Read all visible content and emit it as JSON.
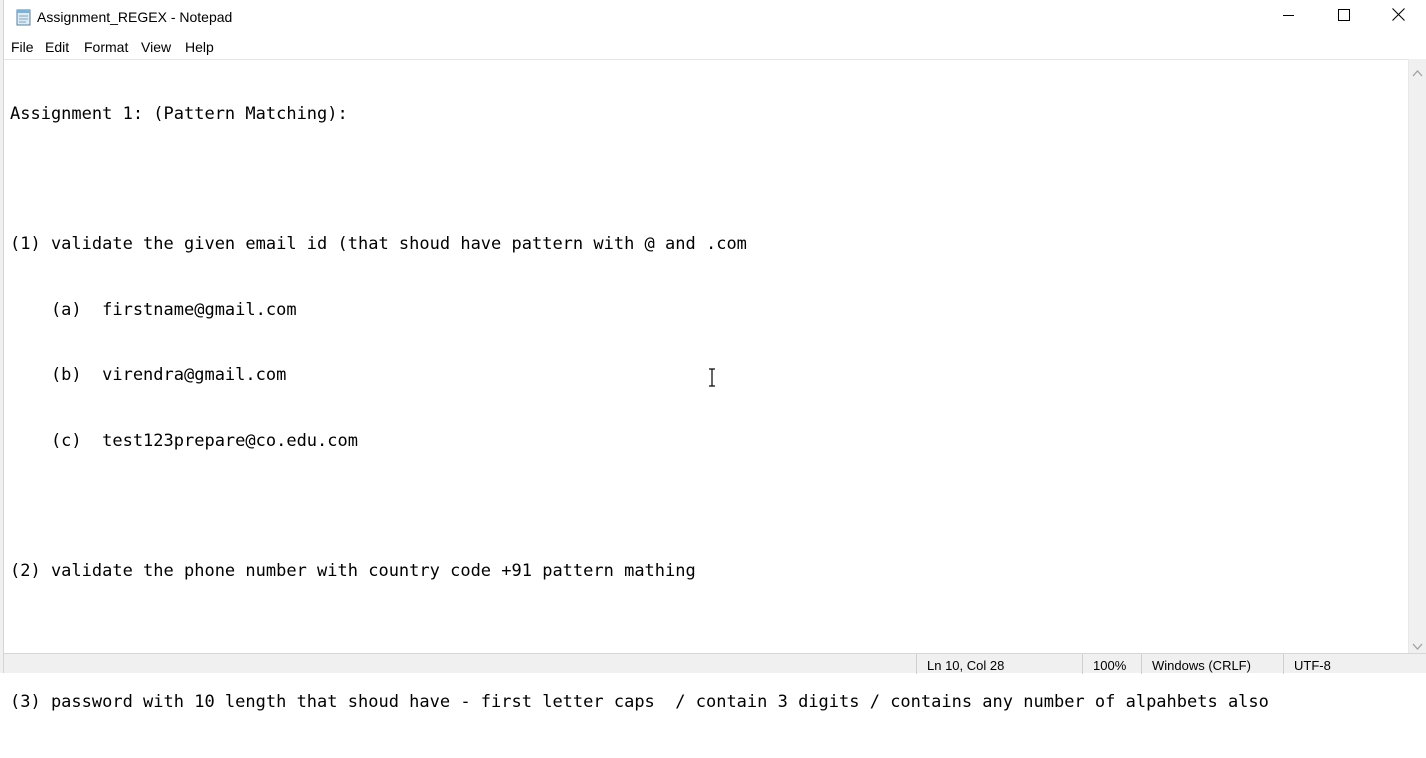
{
  "window": {
    "title": "Assignment_REGEX - Notepad",
    "icon": "notepad-icon",
    "controls": [
      "minimize-icon",
      "maximize-icon",
      "close-icon"
    ]
  },
  "menu": {
    "file": "File",
    "edit": "Edit",
    "format": "Format",
    "view": "View",
    "help": "Help"
  },
  "document": {
    "lines": [
      "Assignment 1: (Pattern Matching):",
      "",
      "(1) validate the given email id (that shoud have pattern with @ and .com",
      "    (a)  firstname@gmail.com",
      "    (b)  virendra@gmail.com",
      "    (c)  test123prepare@co.edu.com",
      "",
      "(2) validate the phone number with country code +91 pattern mathing",
      "",
      "(3) password with 10 length that shoud have - first letter caps  / contain 3 digits / contains any number of alpahbets also"
    ]
  },
  "status": {
    "position": "Ln 10, Col 28",
    "zoom": "100%",
    "line_ending": "Windows (CRLF)",
    "encoding": "UTF-8"
  },
  "colors": {
    "chrome": "#f0f0f0",
    "text": "#000000",
    "editor_bg": "#ffffff"
  }
}
